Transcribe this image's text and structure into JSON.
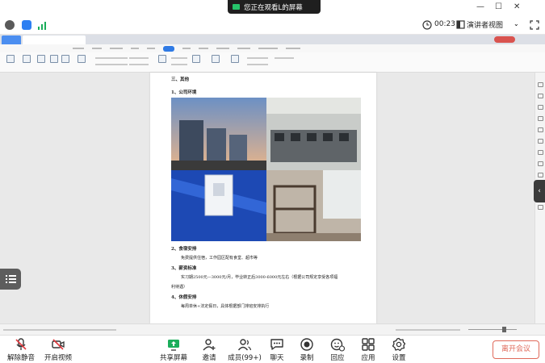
{
  "share_banner": {
    "text": "您正在观看L的屏幕"
  },
  "info_bar": {
    "timer": "00:23",
    "view_mode": "演讲者视图"
  },
  "document": {
    "heading": "三、其他",
    "section1": "1、公司环境",
    "section2": "2、食宿安排",
    "section2_body": "免费提供住宿，工作园区配有食堂、超市等",
    "section3": "3、薪资标准",
    "section3_body_line1": "实习期2500元—3000元/月，毕业转正后3000-6000元左右（根据公司规定享受各项福",
    "section3_body_line2": "利待遇）",
    "section4": "4、休假安排",
    "section4_body": "每周单休+法定假日，具体根据部门排班安排执行"
  },
  "bottom_toolbar": {
    "items": [
      {
        "label": "解除静音",
        "icon": "mic-muted-icon"
      },
      {
        "label": "开启视频",
        "icon": "camera-off-icon"
      },
      {
        "label": "共享屏幕",
        "icon": "share-screen-icon"
      },
      {
        "label": "邀请",
        "icon": "invite-icon"
      },
      {
        "label": "成员(99+)",
        "icon": "members-icon"
      },
      {
        "label": "聊天",
        "icon": "chat-icon"
      },
      {
        "label": "录制",
        "icon": "record-icon"
      },
      {
        "label": "回应",
        "icon": "reaction-icon"
      },
      {
        "label": "应用",
        "icon": "apps-icon"
      },
      {
        "label": "设置",
        "icon": "settings-icon"
      }
    ],
    "leave_label": "离开会议"
  },
  "colors": {
    "accent_green": "#1aad5a",
    "leave_red": "#e06a5b",
    "wps_blue": "#2f7ae5"
  }
}
